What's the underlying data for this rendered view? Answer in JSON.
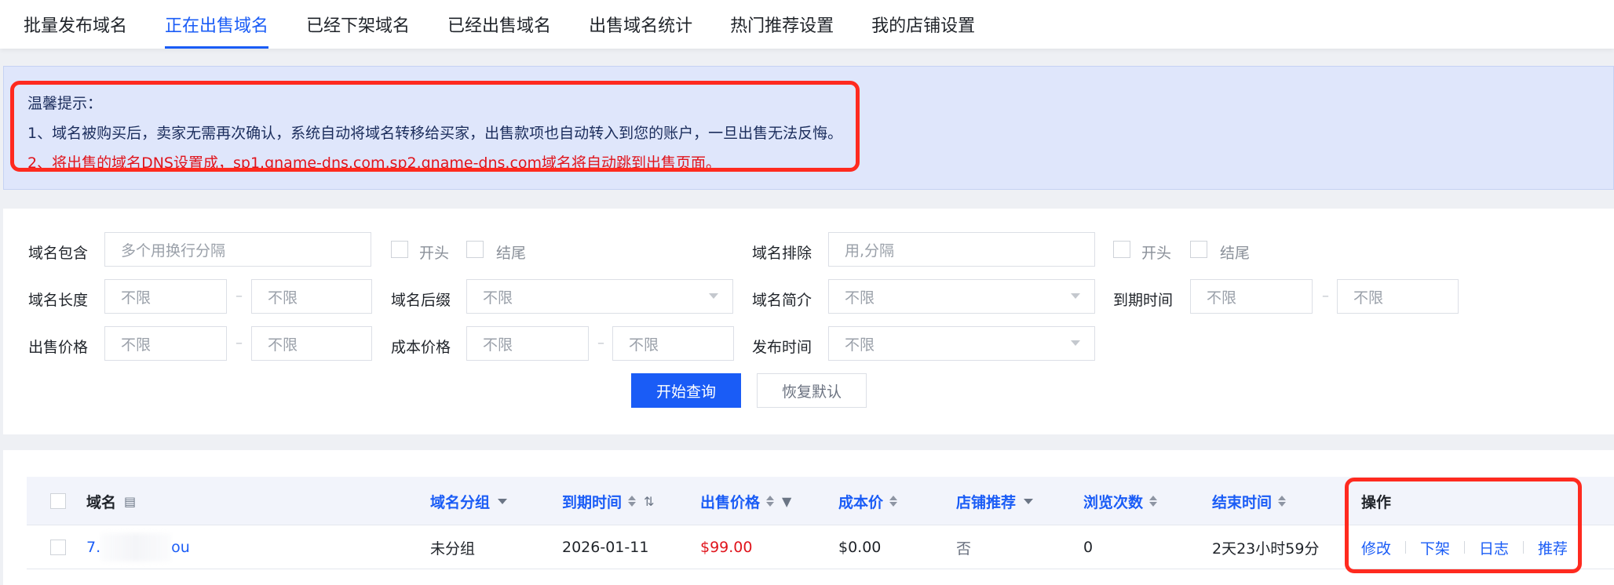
{
  "tabs": [
    {
      "label": "批量发布域名",
      "active": false
    },
    {
      "label": "正在出售域名",
      "active": true
    },
    {
      "label": "已经下架域名",
      "active": false
    },
    {
      "label": "已经出售域名",
      "active": false
    },
    {
      "label": "出售域名统计",
      "active": false
    },
    {
      "label": "热门推荐设置",
      "active": false
    },
    {
      "label": "我的店铺设置",
      "active": false
    }
  ],
  "notice": {
    "title": "温馨提示：",
    "line1": "1、域名被购买后，卖家无需再次确认，系统自动将域名转移给买家，出售款项也自动转入到您的账户，一旦出售无法反悔。",
    "line2": "2、将出售的域名DNS设置成，sp1.gname-dns.com,sp2.gname-dns.com域名将自动跳到出售页面。"
  },
  "filters": {
    "contains_label": "域名包含",
    "contains_placeholder": "多个用换行分隔",
    "start_label": "开头",
    "end_label": "结尾",
    "exclude_label": "域名排除",
    "exclude_placeholder": "用,分隔",
    "length_label": "域名长度",
    "suffix_label": "域名后缀",
    "intro_label": "域名简介",
    "expire_label": "到期时间",
    "sale_price_label": "出售价格",
    "cost_price_label": "成本价格",
    "publish_time_label": "发布时间",
    "unlimited": "不限",
    "dash": "–",
    "search_button": "开始查询",
    "reset_button": "恢复默认"
  },
  "table": {
    "headers": {
      "domain": "域名",
      "group": "域名分组",
      "expire": "到期时间",
      "price": "出售价格",
      "cost": "成本价",
      "recommend": "店铺推荐",
      "views": "浏览次数",
      "end": "结束时间",
      "ops": "操作"
    },
    "rows": [
      {
        "domain_prefix": "7.",
        "domain_suffix": "ou",
        "group": "未分组",
        "expire": "2026-01-11",
        "price": "$99.00",
        "cost": "$0.00",
        "recommend": "否",
        "views": "0",
        "end": "2天23小时59分",
        "ops": [
          "修改",
          "下架",
          "日志",
          "推荐"
        ]
      }
    ]
  },
  "colors": {
    "accent": "#1a5cf6",
    "price": "#e0141c",
    "highlight": "#ff2a1f",
    "notice_bg": "#dfe6fb"
  }
}
